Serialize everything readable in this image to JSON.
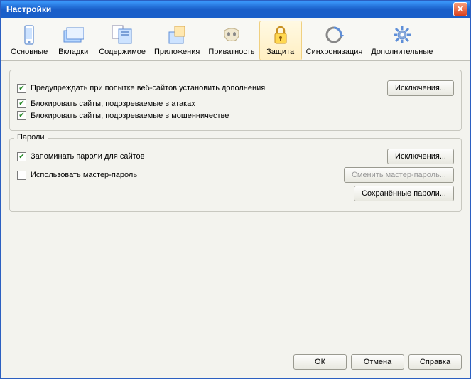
{
  "window": {
    "title": "Настройки"
  },
  "tabs": {
    "general": "Основные",
    "tabs": "Вкладки",
    "content": "Содержимое",
    "apps": "Приложения",
    "privacy": "Приватность",
    "security": "Защита",
    "sync": "Синхронизация",
    "advanced": "Дополнительные"
  },
  "security": {
    "warn_addons": "Предупреждать при попытке веб-сайтов установить дополнения",
    "block_attack": "Блокировать сайты, подозреваемые в атаках",
    "block_fraud": "Блокировать сайты, подозреваемые в мошенничестве",
    "exceptions": "Исключения..."
  },
  "passwords": {
    "legend": "Пароли",
    "remember": "Запоминать пароли для сайтов",
    "master": "Использовать мастер-пароль",
    "exceptions": "Исключения...",
    "change_master": "Сменить мастер-пароль...",
    "saved": "Сохранённые пароли..."
  },
  "footer": {
    "ok": "ОК",
    "cancel": "Отмена",
    "help": "Справка"
  }
}
